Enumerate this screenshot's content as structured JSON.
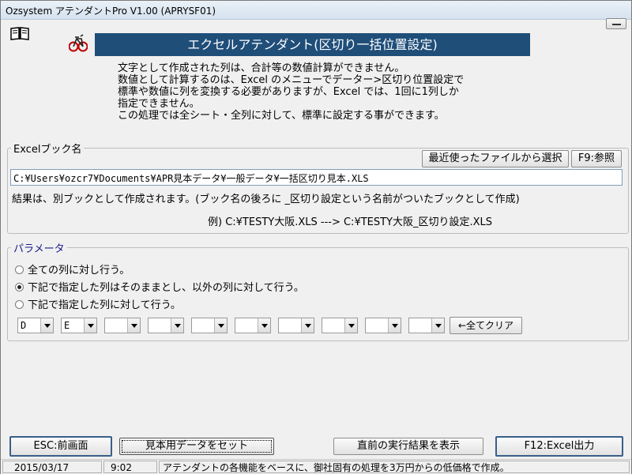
{
  "window": {
    "title": "Ozsystem アテンダントPro V1.00 (APRYSF01)"
  },
  "icons": {
    "help": "book-icon",
    "logo": "bicycle-icon",
    "window_button": "minimize-icon"
  },
  "header": {
    "banner": "エクセルアテンダント(区切り一括位置設定)",
    "banner_color": "#1f4e79",
    "description": [
      "文字として作成された列は、合計等の数値計算ができません。",
      "数値として計算するのは、Excel のメニューでデーター>区切り位置設定で",
      "標準や数値に列を変換する必要がありますが、Excel では、1回に1列しか",
      "指定できません。",
      "この処理では全シート・全列に対して、標準に設定する事ができます。"
    ]
  },
  "excel_book": {
    "legend": "Excelブック名",
    "recent_button": "最近使ったファイルから選択",
    "browse_button": "F9:参照",
    "path": "C:¥Users¥ozcr7¥Documents¥APR見本データ¥一般データ¥一括区切り見本.XLS",
    "result_note": "結果は、別ブックとして作成されます。(ブック名の後ろに _区切り設定という名前がついたブックとして作成)",
    "example": "例) C:¥TESTY大阪.XLS  --->  C:¥TESTY大阪_区切り設定.XLS"
  },
  "parameters": {
    "legend": "パラメータ",
    "options": [
      {
        "label": "全ての列に対し行う。",
        "selected": false
      },
      {
        "label": "下記で指定した列はそのままとし、以外の列に対して行う。",
        "selected": true
      },
      {
        "label": "下記で指定した列に対して行う。",
        "selected": false
      }
    ],
    "columns": [
      "D",
      "E",
      "",
      "",
      "",
      "",
      "",
      "",
      "",
      ""
    ],
    "clear_button": "←全てクリア"
  },
  "footer": {
    "esc_button": "ESC:前画面",
    "sample_button": "見本用データをセット",
    "prev_result_button": "直前の実行結果を表示",
    "f12_button": "F12:Excel出力"
  },
  "statusbar": {
    "date": "2015/03/17",
    "time": "9:02",
    "message": "アテンダントの各機能をベースに、御社固有の処理を3万円からの低価格で作成。"
  }
}
